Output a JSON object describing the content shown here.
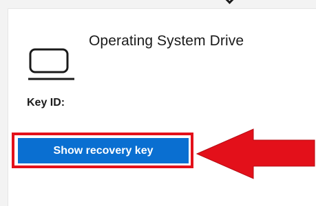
{
  "drive": {
    "title": "Operating System Drive",
    "key_id_label": "Key ID:",
    "icon": "laptop-icon"
  },
  "actions": {
    "show_recovery_key_label": "Show recovery key"
  },
  "annotation": {
    "highlight_color": "#e3101a",
    "arrow_color": "#e3101a"
  },
  "colors": {
    "button_bg": "#0a6fd1",
    "button_text": "#ffffff",
    "card_bg": "#ffffff",
    "page_bg": "#f3f3f3"
  }
}
